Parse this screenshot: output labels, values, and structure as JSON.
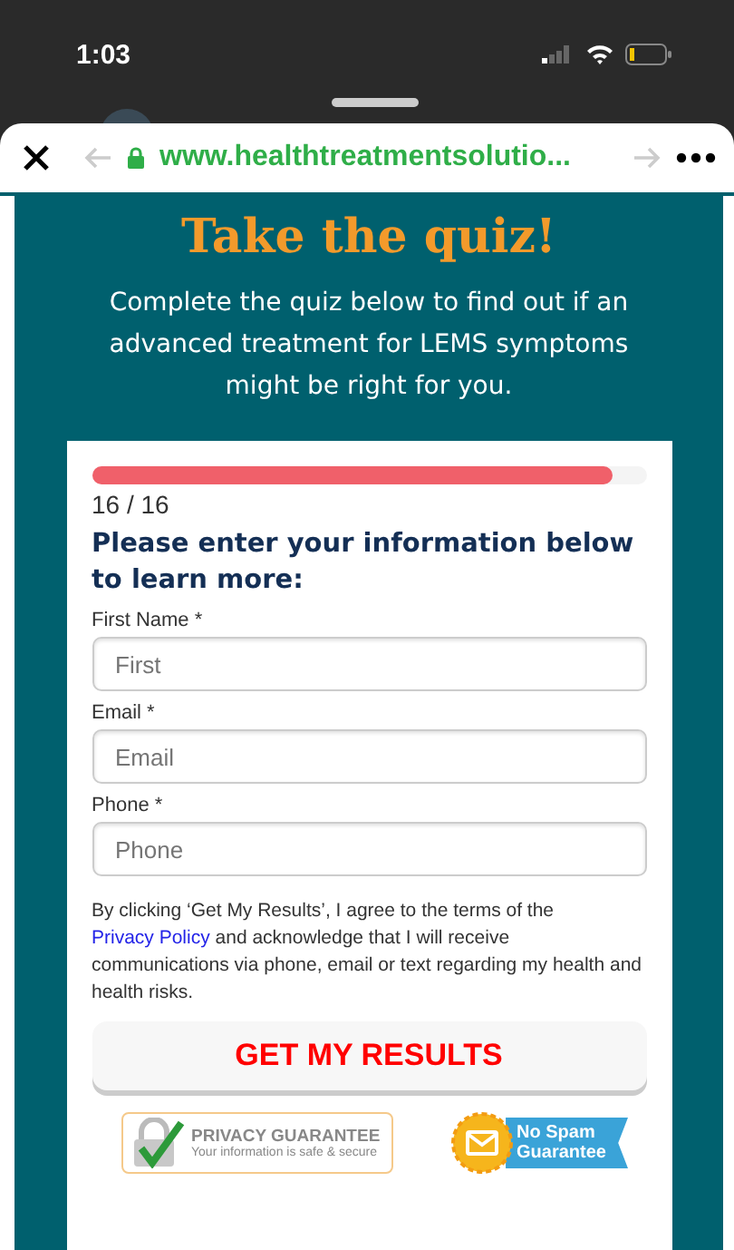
{
  "status_bar": {
    "time": "1:03"
  },
  "browser": {
    "url": "www.healthtreatmentsolutio..."
  },
  "hero": {
    "title": "Take the quiz!",
    "subtitle": "Complete the quiz below to find out if an advanced treatment for LEMS symptoms might be right for you."
  },
  "form": {
    "progress": {
      "level": 0.94,
      "label": "16 / 16"
    },
    "heading": "Please enter your information below to learn more:",
    "fields": [
      {
        "label": "First Name *",
        "placeholder": "First"
      },
      {
        "label": "Email *",
        "placeholder": "Email"
      },
      {
        "label": "Phone *",
        "placeholder": "Phone"
      }
    ],
    "consent": {
      "before": "By clicking ‘Get My Results’, I agree to the terms of the",
      "link": "Privacy Policy",
      "after": "and acknowledge that I will receive communications via phone, email or text regarding my health and health risks."
    },
    "submit": "GET MY RESULTS",
    "badges": [
      {
        "kind": "privacy",
        "title": "PRIVACY GUARANTEE",
        "subtitle": "Your information is safe & secure"
      },
      {
        "kind": "no_spam",
        "title": "No Spam",
        "subtitle": "Guarantee"
      }
    ]
  }
}
